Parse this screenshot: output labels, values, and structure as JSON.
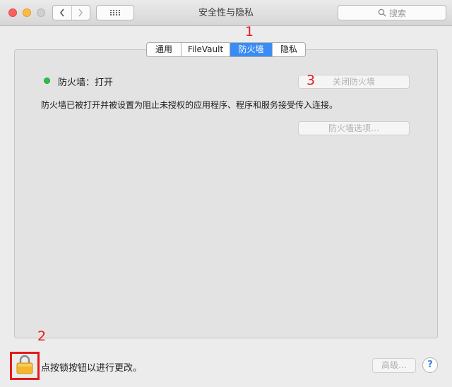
{
  "window": {
    "title": "安全性与隐私"
  },
  "toolbar": {
    "back_icon": "chevron-left-icon",
    "forward_icon": "chevron-right-icon",
    "grid_icon": "grid-icon",
    "search_placeholder": "搜索"
  },
  "tabs": [
    {
      "label": "通用",
      "active": false
    },
    {
      "label": "FileVault",
      "active": false
    },
    {
      "label": "防火墙",
      "active": true
    },
    {
      "label": "隐私",
      "active": false
    }
  ],
  "firewall": {
    "status_label": "防火墙：打开",
    "status_color": "#2ac045",
    "turn_off_button": "关闭防火墙",
    "description": "防火墙已被打开并被设置为阻止未授权的应用程序、程序和服务接受传入连接。",
    "options_button": "防火墙选项…"
  },
  "footer": {
    "lock_text": "点按锁按钮以进行更改。",
    "advanced_button": "高级…",
    "help_label": "?"
  },
  "annotations": {
    "a1": "1",
    "a2": "2",
    "a3": "3",
    "color": "#e31b1b"
  }
}
